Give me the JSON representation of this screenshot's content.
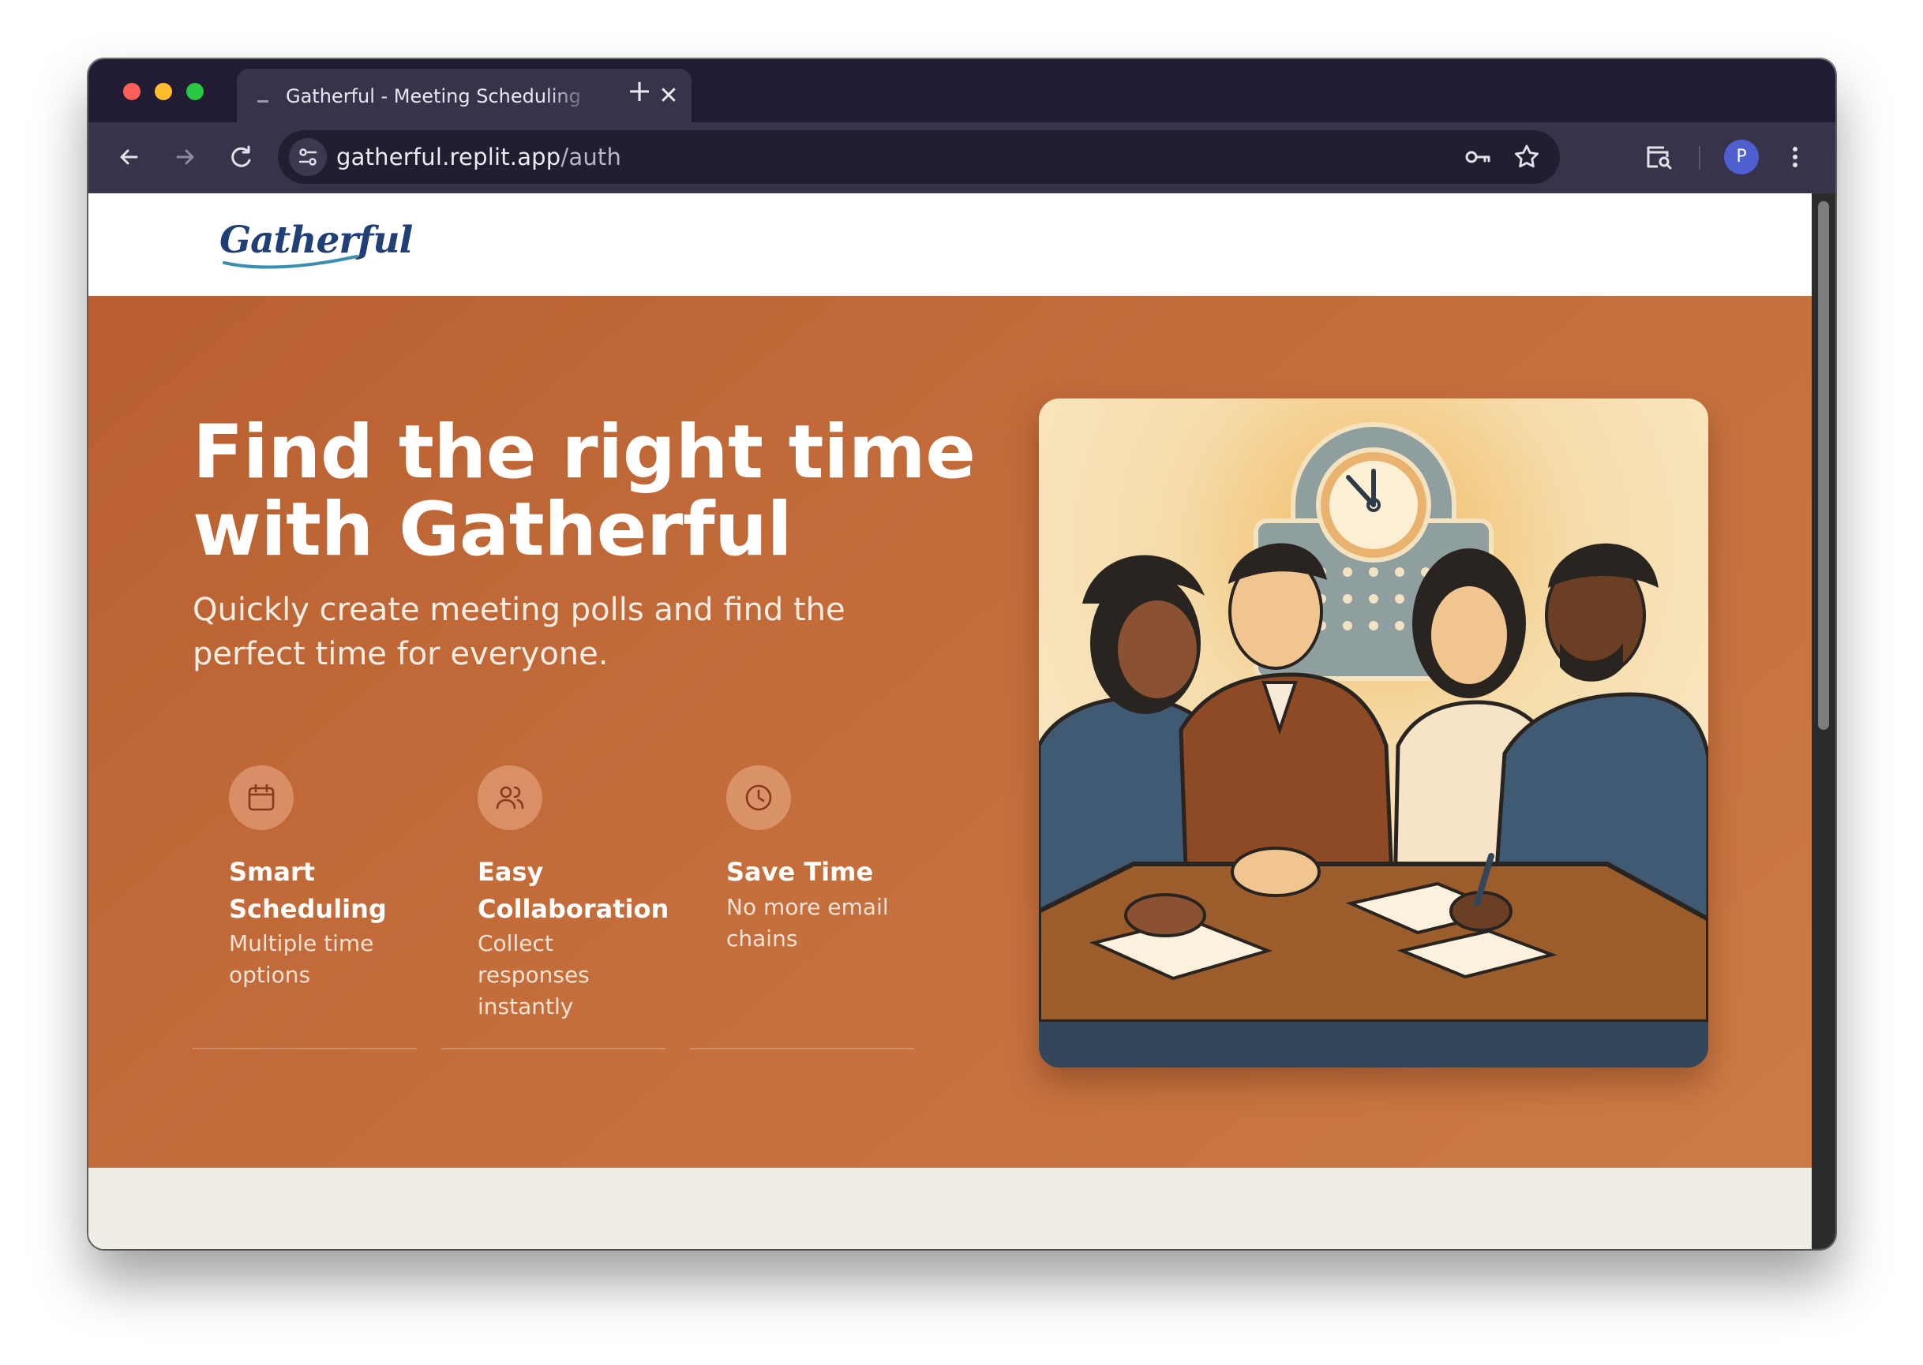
{
  "browser": {
    "tab_title": "Gatherful - Meeting Scheduling",
    "new_tab_symbol": "+",
    "close_symbol": "✕",
    "url_host": "gatherful.replit.app",
    "url_path": "/auth",
    "profile_initial": "P"
  },
  "site": {
    "logo_text": "Gatherful"
  },
  "hero": {
    "title": "Find the right time with Gatherful",
    "subtitle": "Quickly create meeting polls and find the perfect time for everyone."
  },
  "features": [
    {
      "icon": "calendar-icon",
      "title": "Smart Scheduling",
      "desc": "Multiple time options"
    },
    {
      "icon": "users-icon",
      "title": "Easy Collaboration",
      "desc": "Collect responses instantly"
    },
    {
      "icon": "clock-icon",
      "title": "Save Time",
      "desc": "No more email chains"
    }
  ],
  "colors": {
    "hero_bg": "#c46d3b",
    "logo_blue": "#1f3f76",
    "tabbar_bg": "#211c33",
    "toolbar_bg": "#37334a"
  }
}
